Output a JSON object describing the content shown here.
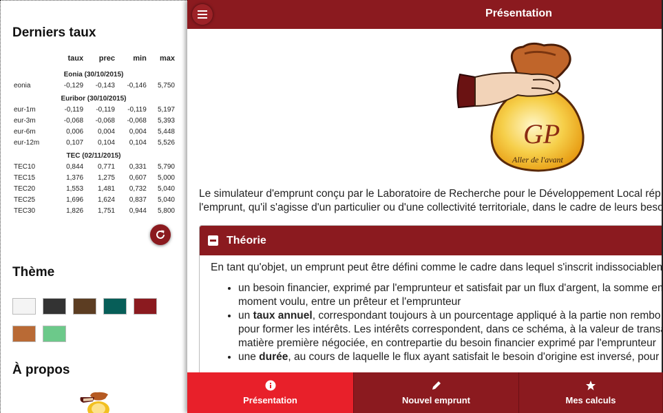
{
  "sidebar": {
    "rates_title": "Derniers taux",
    "columns": [
      "taux",
      "prec",
      "min",
      "max"
    ],
    "groups": [
      {
        "title": "Eonia (30/10/2015)",
        "rows": [
          {
            "name": "eonia",
            "values": [
              "-0,129",
              "-0,143",
              "-0,146",
              "5,750"
            ]
          }
        ]
      },
      {
        "title": "Euribor (30/10/2015)",
        "rows": [
          {
            "name": "eur-1m",
            "values": [
              "-0,119",
              "-0,119",
              "-0,119",
              "5,197"
            ]
          },
          {
            "name": "eur-3m",
            "values": [
              "-0,068",
              "-0,068",
              "-0,068",
              "5,393"
            ]
          },
          {
            "name": "eur-6m",
            "values": [
              "0,006",
              "0,004",
              "0,004",
              "5,448"
            ]
          },
          {
            "name": "eur-12m",
            "values": [
              "0,107",
              "0,104",
              "0,104",
              "5,526"
            ]
          }
        ]
      },
      {
        "title": "TEC (02/11/2015)",
        "rows": [
          {
            "name": "TEC10",
            "values": [
              "0,844",
              "0,771",
              "0,331",
              "5,790"
            ]
          },
          {
            "name": "TEC15",
            "values": [
              "1,376",
              "1,275",
              "0,607",
              "5,000"
            ]
          },
          {
            "name": "TEC20",
            "values": [
              "1,553",
              "1,481",
              "0,732",
              "5,040"
            ]
          },
          {
            "name": "TEC25",
            "values": [
              "1,696",
              "1,624",
              "0,837",
              "5,040"
            ]
          },
          {
            "name": "TEC30",
            "values": [
              "1,826",
              "1,751",
              "0,944",
              "5,800"
            ]
          }
        ]
      }
    ],
    "refresh_icon": "refresh-icon",
    "theme_title": "Thème",
    "theme_colors": [
      "#f4f4f4",
      "#333333",
      "#5c3d22",
      "#075e58",
      "#8b1a1f",
      "#b96a35",
      "#6cc98a"
    ],
    "about_title": "À propos"
  },
  "header": {
    "title": "Présentation",
    "menu_icon": "hamburger-menu-icon"
  },
  "logo": {
    "initials": "GP",
    "tagline": "Aller de l'avant"
  },
  "main": {
    "intro_line1": "Le simulateur d'emprunt conçu par le Laboratoire de Recherche pour le Développement Local rép",
    "intro_line2": "l'emprunt, qu'il s'agisse d'un particulier ou d'une collectivité territoriale, dans le cadre de leurs beso",
    "section": {
      "title": "Théorie",
      "lead": "En tant qu'objet, un emprunt peut être défini comme le cadre dans lequel s'inscrit indissociablem",
      "bullets": [
        {
          "pre": "un besoin financier, exprimé par l'emprunteur et satisfait par un flux d'argent, la somme em",
          "bold": "",
          "post": "",
          "cont": [
            "moment voulu, entre un prêteur et l'emprunteur"
          ]
        },
        {
          "pre": "un ",
          "bold": "taux annuel",
          "post": ", correspondant toujours à un pourcentage appliqué à la partie non rembo",
          "cont": [
            "pour former les intérêts. Les intérêts correspondent, dans ce schéma, à la valeur de transa",
            "matière première négociée, en contrepartie du besoin financier exprimé par l'emprunteur"
          ]
        },
        {
          "pre": "une ",
          "bold": "durée",
          "post": ", au cours de laquelle le flux ayant satisfait le besoin d'origine est inversé, pour p",
          "cont": []
        }
      ]
    }
  },
  "bottom_nav": {
    "presentation": {
      "label": "Présentation",
      "icon": "info-icon"
    },
    "new_loan": {
      "label": "Nouvel emprunt",
      "icon": "pencil-icon"
    },
    "my_calcs": {
      "label": "Mes calculs",
      "icon": "star-icon"
    }
  },
  "colors": {
    "primary": "#8b1a1f",
    "active": "#e8202a"
  }
}
